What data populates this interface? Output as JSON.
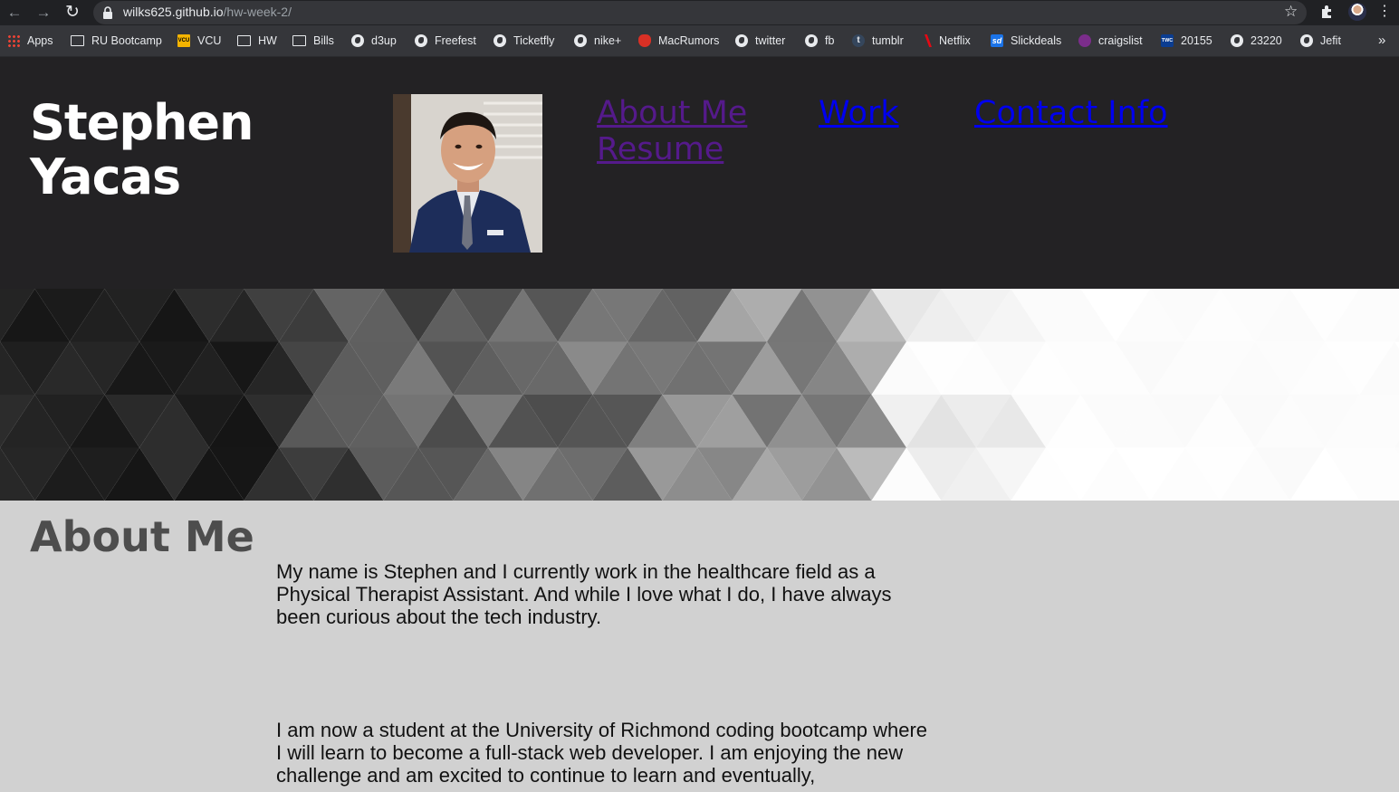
{
  "browser": {
    "url_domain": "wilks625.github.io",
    "url_path": "/hw-week-2/",
    "bookmarks": [
      {
        "label": "Apps",
        "icon": "apps-grid-icon"
      },
      {
        "label": "RU Bootcamp",
        "icon": "folder-icon"
      },
      {
        "label": "VCU",
        "icon": "vcu-icon"
      },
      {
        "label": "HW",
        "icon": "folder-icon"
      },
      {
        "label": "Bills",
        "icon": "folder-icon"
      },
      {
        "label": "d3up",
        "icon": "globe-icon"
      },
      {
        "label": "Freefest",
        "icon": "globe-icon"
      },
      {
        "label": "Ticketfly",
        "icon": "globe-icon"
      },
      {
        "label": "nike+",
        "icon": "globe-icon"
      },
      {
        "label": "MacRumors",
        "icon": "macrumors-icon"
      },
      {
        "label": "twitter",
        "icon": "globe-icon"
      },
      {
        "label": "fb",
        "icon": "globe-icon"
      },
      {
        "label": "tumblr",
        "icon": "tumblr-icon"
      },
      {
        "label": "Netflix",
        "icon": "netflix-icon"
      },
      {
        "label": "Slickdeals",
        "icon": "slickdeals-icon"
      },
      {
        "label": "craigslist",
        "icon": "craigslist-icon"
      },
      {
        "label": "20155",
        "icon": "twc-icon"
      },
      {
        "label": "23220",
        "icon": "globe-icon"
      },
      {
        "label": "Jefit",
        "icon": "globe-icon"
      }
    ],
    "bookmark_icon_texts": {
      "vcu": "VCU",
      "tumblr": "t",
      "sd": "sd",
      "twc": "TWC"
    },
    "more_bookmarks": "»"
  },
  "header": {
    "name": "Stephen Yacas",
    "nav": {
      "about": "About Me",
      "resume": "Resume",
      "work": "Work",
      "contact": "Contact Info"
    },
    "colors": {
      "background": "#232224",
      "visited_link": "#551a8b",
      "link": "#0000ee"
    }
  },
  "about": {
    "heading": "About Me",
    "paragraph1": "My name is Stephen and I currently work in the healthcare field as a Physical Therapist Assistant. And while I love what I do, I have always been curious about the tech industry.",
    "paragraph2": "I am now a student at the University of Richmond coding bootcamp where I will learn to become a full-stack web developer. I am enjoying the new challenge and am excited to continue to learn and eventually,"
  }
}
